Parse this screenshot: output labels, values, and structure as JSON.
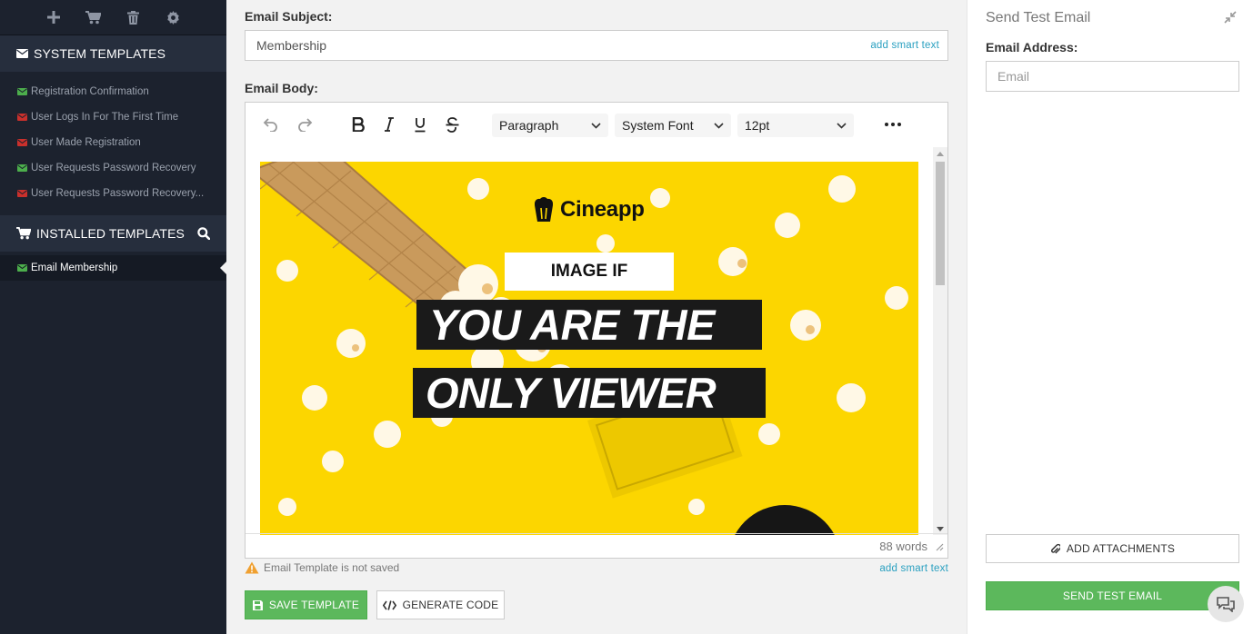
{
  "sidebar": {
    "toolbar_icons": [
      "plus-icon",
      "cart-icon",
      "trash-icon",
      "gear-icon"
    ],
    "system_templates": {
      "title": "SYSTEM TEMPLATES",
      "items": [
        {
          "label": "Registration Confirmation",
          "status_color": "#4cae4c"
        },
        {
          "label": "User Logs In For The First Time",
          "status_color": "#c9302c"
        },
        {
          "label": "User Made Registration",
          "status_color": "#c9302c"
        },
        {
          "label": "User Requests Password Recovery",
          "status_color": "#4cae4c"
        },
        {
          "label": "User Requests Password Recovery...",
          "status_color": "#c9302c"
        }
      ]
    },
    "installed_templates": {
      "title": "INSTALLED TEMPLATES",
      "items": [
        {
          "label": "Email Membership",
          "status_color": "#4cae4c",
          "active": true
        }
      ]
    }
  },
  "main": {
    "subject_label": "Email Subject:",
    "subject_value": "Membership",
    "smart_text": "add smart text",
    "body_label": "Email Body:",
    "toolbar": {
      "block_format": "Paragraph",
      "font_family": "System Font",
      "font_size": "12pt"
    },
    "banner": {
      "logo_text": "Cineapp",
      "tag": "IMAGE IF",
      "line1": "YOU ARE THE",
      "line2": "ONLY VIEWER",
      "background_color": "#fcd600"
    },
    "word_count": "88 words",
    "warning": "Email Template is not saved",
    "save_label": "SAVE TEMPLATE",
    "generate_label": "GENERATE CODE"
  },
  "panel": {
    "title": "Send Test Email",
    "address_label": "Email Address:",
    "email_placeholder": "Email",
    "attach_label": "ADD ATTACHMENTS",
    "send_label": "SEND TEST EMAIL"
  },
  "colors": {
    "sidebar_bg": "#1c222e",
    "accent_green": "#5cb85c",
    "link_blue": "#2aa0c0"
  }
}
